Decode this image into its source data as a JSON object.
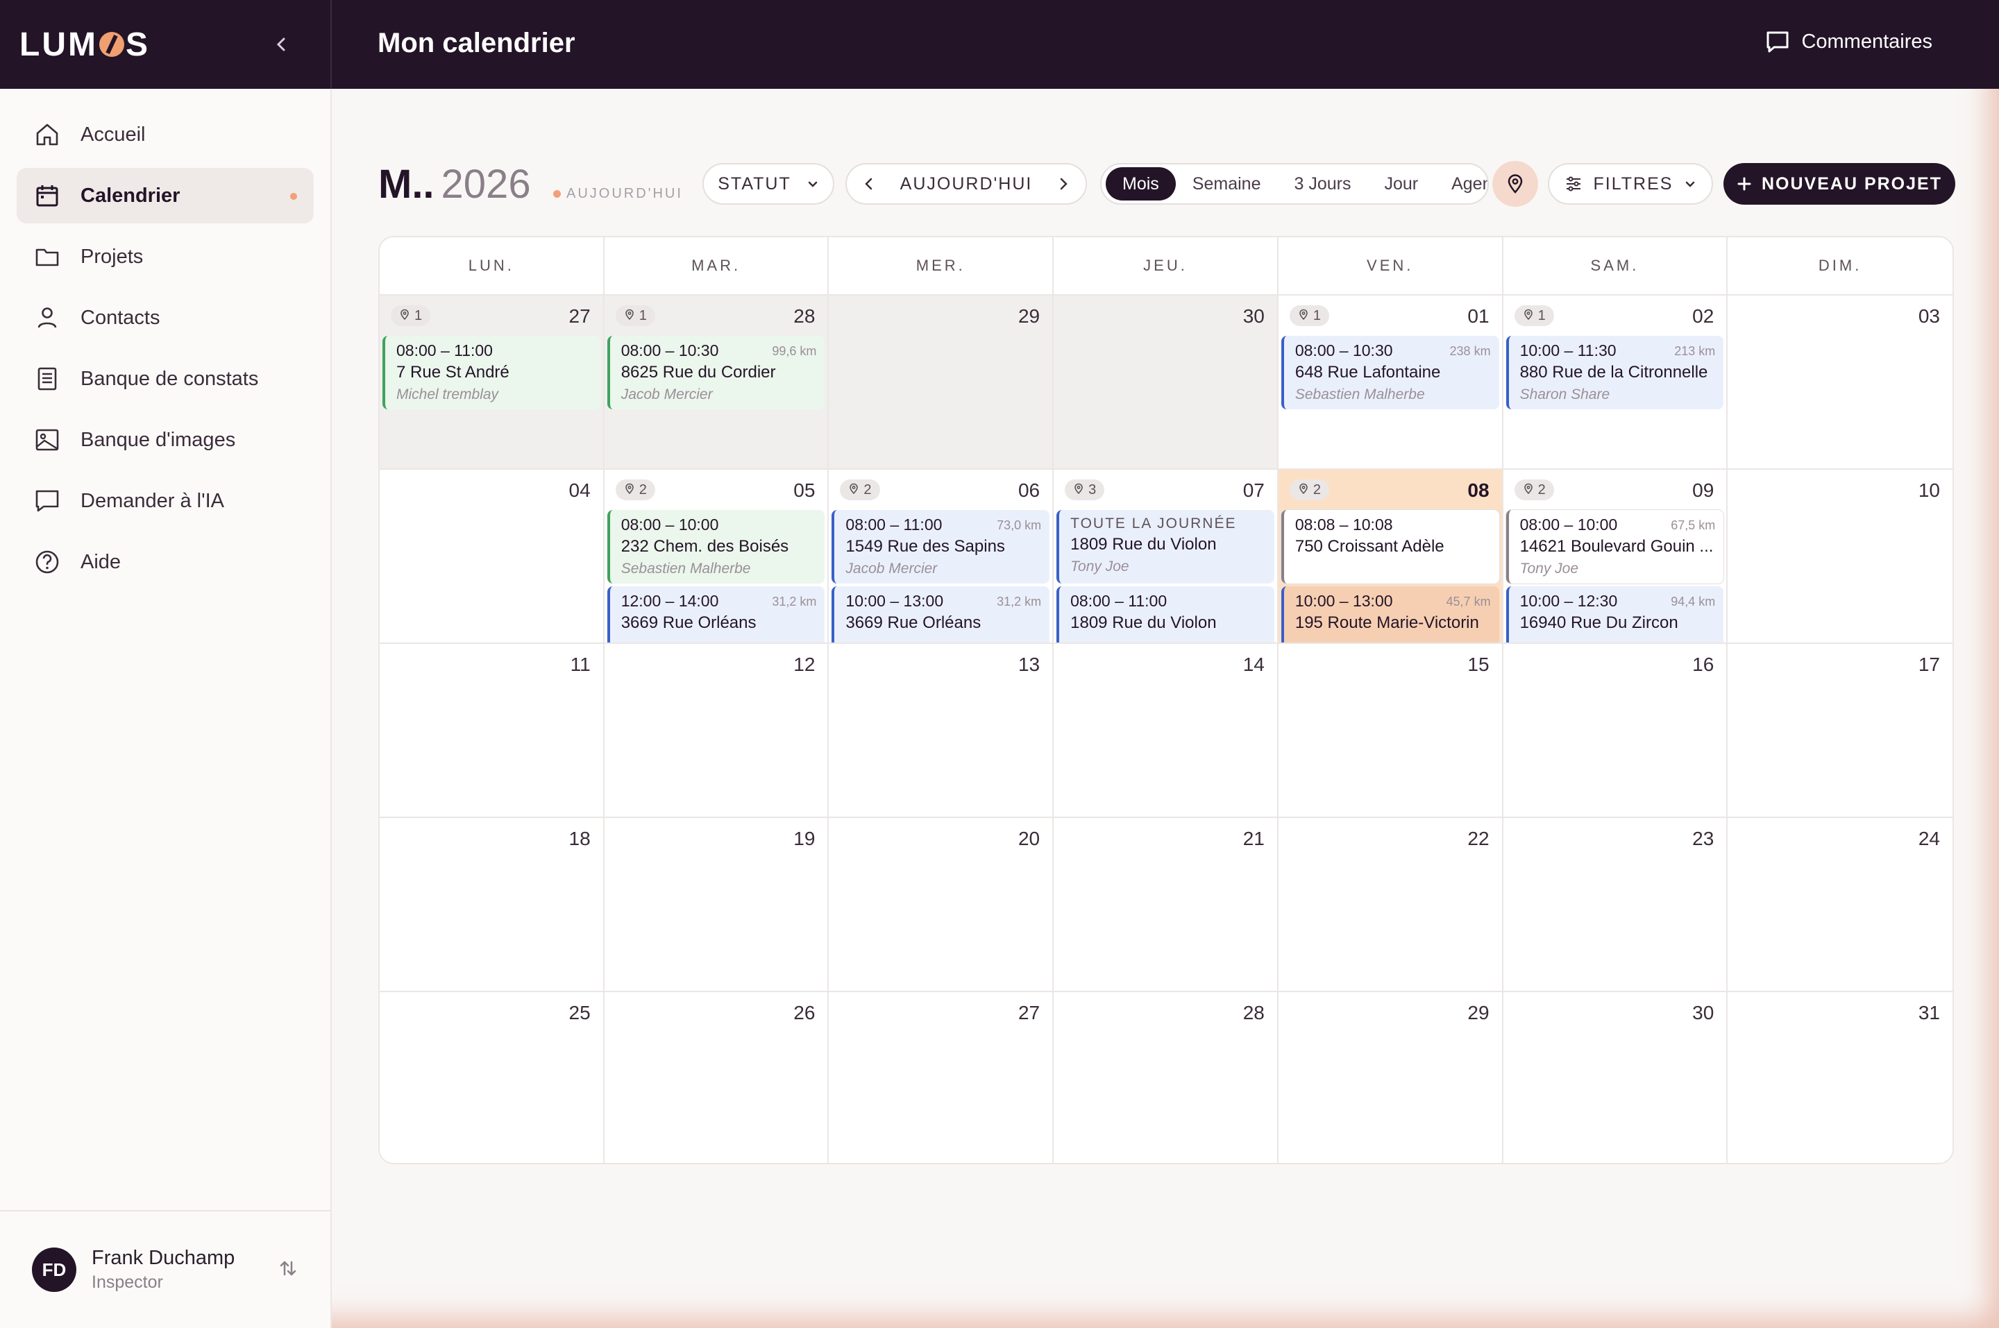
{
  "header": {
    "logo": "LUMOS",
    "title": "Mon calendrier",
    "comments_label": "Commentaires"
  },
  "sidebar": {
    "items": [
      {
        "label": "Accueil",
        "icon": "home-icon"
      },
      {
        "label": "Calendrier",
        "icon": "calendar-icon",
        "active": true
      },
      {
        "label": "Projets",
        "icon": "folder-icon"
      },
      {
        "label": "Contacts",
        "icon": "user-icon"
      },
      {
        "label": "Banque de constats",
        "icon": "document-icon"
      },
      {
        "label": "Banque d'images",
        "icon": "image-icon"
      },
      {
        "label": "Demander à l'IA",
        "icon": "chat-icon"
      },
      {
        "label": "Aide",
        "icon": "help-icon"
      }
    ],
    "user": {
      "initials": "FD",
      "name": "Frank Duchamp",
      "role": "Inspector"
    }
  },
  "toolbar": {
    "month_short": "M..",
    "year": "2026",
    "today_tag": "AUJOURD'HUI",
    "status_label": "STATUT",
    "today_button": "AUJOURD'HUI",
    "views": [
      "Mois",
      "Semaine",
      "3 Jours",
      "Jour",
      "Agen"
    ],
    "active_view": "Mois",
    "filters_label": "FILTRES",
    "new_project_label": "NOUVEAU PROJET"
  },
  "colors": {
    "accent": "#231427",
    "highlight": "#f2a079",
    "today_bg": "#fbe0c6"
  },
  "calendar": {
    "weekdays": [
      "LUN.",
      "MAR.",
      "MER.",
      "JEU.",
      "VEN.",
      "SAM.",
      "DIM."
    ],
    "days": [
      {
        "num": "27",
        "other": true,
        "badge": "1",
        "events": [
          {
            "time": "08:00 – 11:00",
            "dist": "",
            "addr": "7 Rue St André",
            "person": "Michel tremblay",
            "color": "green"
          }
        ]
      },
      {
        "num": "28",
        "other": true,
        "badge": "1",
        "events": [
          {
            "time": "08:00 – 10:30",
            "dist": "99,6 km",
            "addr": "8625 Rue du Cordier",
            "person": "Jacob Mercier",
            "color": "green"
          }
        ]
      },
      {
        "num": "29",
        "other": true,
        "events": []
      },
      {
        "num": "30",
        "other": true,
        "events": []
      },
      {
        "num": "01",
        "badge": "1",
        "events": [
          {
            "time": "08:00 – 10:30",
            "dist": "238 km",
            "addr": "648 Rue Lafontaine",
            "person": "Sebastien Malherbe",
            "color": "blue"
          }
        ]
      },
      {
        "num": "02",
        "badge": "1",
        "events": [
          {
            "time": "10:00 – 11:30",
            "dist": "213 km",
            "addr": "880 Rue de la Citronnelle",
            "person": "Sharon Share",
            "color": "blue"
          }
        ]
      },
      {
        "num": "03",
        "events": []
      },
      {
        "num": "04",
        "events": []
      },
      {
        "num": "05",
        "badge": "2",
        "events": [
          {
            "time": "08:00 – 10:00",
            "dist": "",
            "addr": "232 Chem. des Boisés",
            "person": "Sebastien Malherbe",
            "color": "green"
          },
          {
            "time": "12:00 – 14:00",
            "dist": "31,2 km",
            "addr": "3669 Rue Orléans",
            "person": "",
            "color": "blue"
          }
        ]
      },
      {
        "num": "06",
        "badge": "2",
        "events": [
          {
            "time": "08:00 – 11:00",
            "dist": "73,0 km",
            "addr": "1549 Rue des Sapins",
            "person": "Jacob Mercier",
            "color": "blue"
          },
          {
            "time": "10:00 – 13:00",
            "dist": "31,2 km",
            "addr": "3669 Rue Orléans",
            "person": "",
            "color": "blue"
          }
        ]
      },
      {
        "num": "07",
        "badge": "3",
        "events": [
          {
            "allday": "TOUTE LA JOURNÉE",
            "time": "",
            "dist": "",
            "addr": "1809 Rue du Violon",
            "person": "Tony Joe",
            "color": "blue"
          },
          {
            "time": "08:00 – 11:00",
            "dist": "",
            "addr": "1809 Rue du Violon",
            "person": "",
            "color": "blue"
          }
        ]
      },
      {
        "num": "08",
        "today": true,
        "badge": "2",
        "events": [
          {
            "time": "08:08 – 10:08",
            "dist": "",
            "addr": "750 Croissant Adèle",
            "person": "",
            "color": "white"
          },
          {
            "time": "10:00 – 13:00",
            "dist": "45,7 km",
            "addr": "195 Route Marie-Victorin",
            "person": "",
            "color": "peach"
          }
        ]
      },
      {
        "num": "09",
        "badge": "2",
        "events": [
          {
            "time": "08:00 – 10:00",
            "dist": "67,5 km",
            "addr": "14621 Boulevard Gouin ...",
            "person": "Tony Joe",
            "color": "white"
          },
          {
            "time": "10:00 – 12:30",
            "dist": "94,4 km",
            "addr": "16940 Rue Du Zircon",
            "person": "",
            "color": "blue"
          }
        ]
      },
      {
        "num": "10",
        "events": []
      },
      {
        "num": "11",
        "events": []
      },
      {
        "num": "12",
        "events": []
      },
      {
        "num": "13",
        "events": []
      },
      {
        "num": "14",
        "events": []
      },
      {
        "num": "15",
        "events": []
      },
      {
        "num": "16",
        "events": []
      },
      {
        "num": "17",
        "events": []
      },
      {
        "num": "18",
        "events": []
      },
      {
        "num": "19",
        "events": []
      },
      {
        "num": "20",
        "events": []
      },
      {
        "num": "21",
        "events": []
      },
      {
        "num": "22",
        "events": []
      },
      {
        "num": "23",
        "events": []
      },
      {
        "num": "24",
        "events": []
      },
      {
        "num": "25",
        "events": []
      },
      {
        "num": "26",
        "events": []
      },
      {
        "num": "27",
        "events": []
      },
      {
        "num": "28",
        "events": []
      },
      {
        "num": "29",
        "events": []
      },
      {
        "num": "30",
        "events": []
      },
      {
        "num": "31",
        "events": []
      }
    ]
  }
}
